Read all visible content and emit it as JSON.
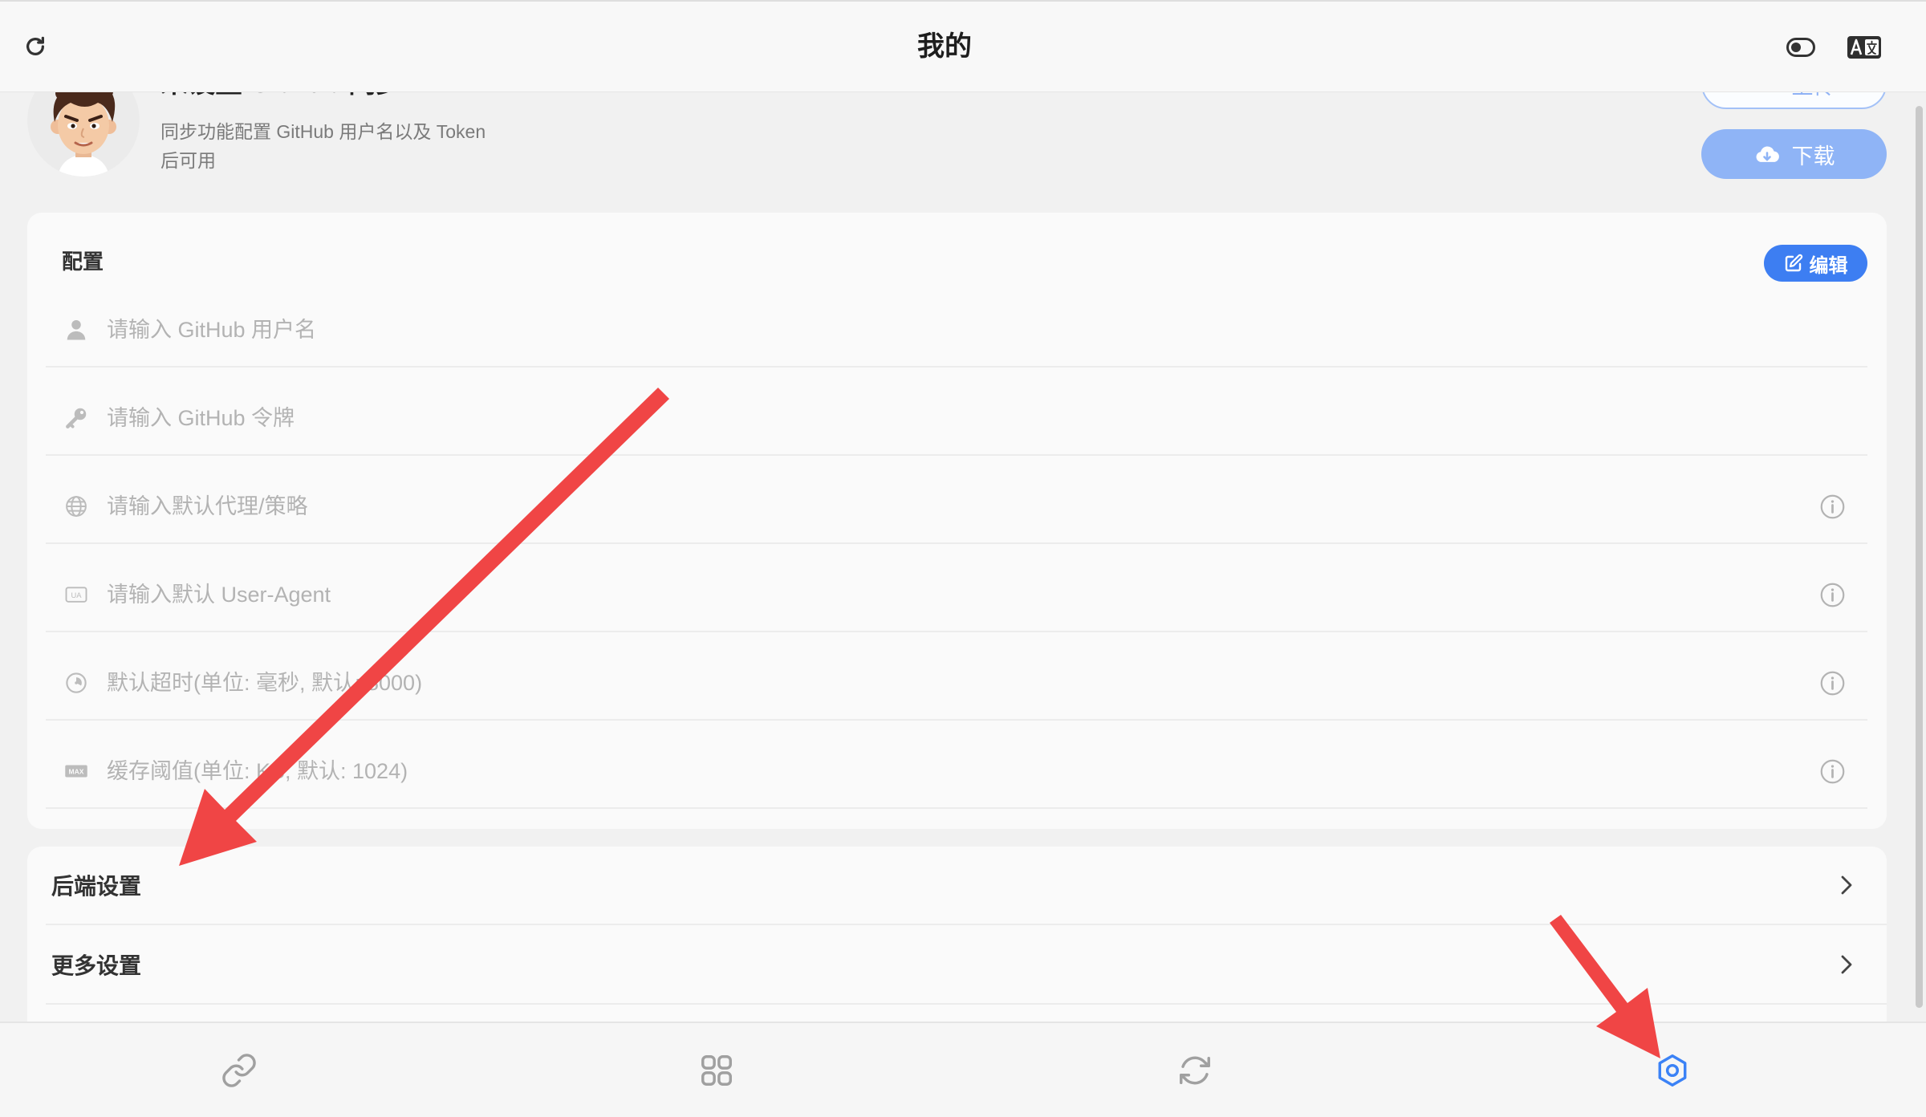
{
  "header": {
    "title": "我的",
    "left_icon": "refresh-icon",
    "right_icons": [
      "theme-toggle-icon",
      "translate-icon"
    ]
  },
  "profile": {
    "avatar_icon": "avatar-icon",
    "name": "未设置 GitHub 同步",
    "subtitle": [
      "同步功能配置 GitHub 用户名以及 Token",
      "后可用"
    ],
    "upload_button": {
      "label": "上传",
      "icon": "cloud-upload-icon"
    },
    "download_button": {
      "label": "下载",
      "icon": "cloud-download-icon"
    }
  },
  "config": {
    "title": "配置",
    "edit_button": {
      "label": "编辑",
      "icon": "edit-icon"
    },
    "fields": [
      {
        "icon": "user-icon",
        "value": "",
        "placeholder": "请输入 GitHub 用户名",
        "has_info": false
      },
      {
        "icon": "key-icon",
        "value": "",
        "placeholder": "请输入 GitHub 令牌",
        "has_info": false
      },
      {
        "icon": "globe-icon",
        "value": "",
        "placeholder": "请输入默认代理/策略",
        "has_info": true
      },
      {
        "icon": "ua-icon",
        "badge": "UA",
        "value": "",
        "placeholder": "请输入默认 User-Agent",
        "has_info": true
      },
      {
        "icon": "timer-icon",
        "value": "",
        "placeholder": "默认超时(单位: 毫秒, 默认: 8000)",
        "has_info": true
      },
      {
        "icon": "max-icon",
        "badge": "MAX",
        "value": "",
        "placeholder": "缓存阈值(单位: KB, 默认: 1024)",
        "has_info": true
      }
    ]
  },
  "menu": [
    {
      "label": "后端设置",
      "icon": "chevron-right-icon"
    },
    {
      "label": "更多设置",
      "icon": "chevron-right-icon"
    }
  ],
  "tab_bar": [
    {
      "icon": "link-icon",
      "active": false
    },
    {
      "icon": "grid-icon",
      "active": false
    },
    {
      "icon": "sync-icon",
      "active": false
    },
    {
      "icon": "settings-icon",
      "active": true
    }
  ],
  "annotations": {
    "icon": "red-arrow-icon",
    "color": "#f04545"
  },
  "colors": {
    "accent": "#3d7ef2",
    "download_button": "#8fb4f6",
    "active_tab": "#3b82f6",
    "inactive_tab": "#a0a0a0",
    "placeholder": "#b3b3b3",
    "card_background": "#fafafa",
    "page_background": "#f1f1f1"
  }
}
